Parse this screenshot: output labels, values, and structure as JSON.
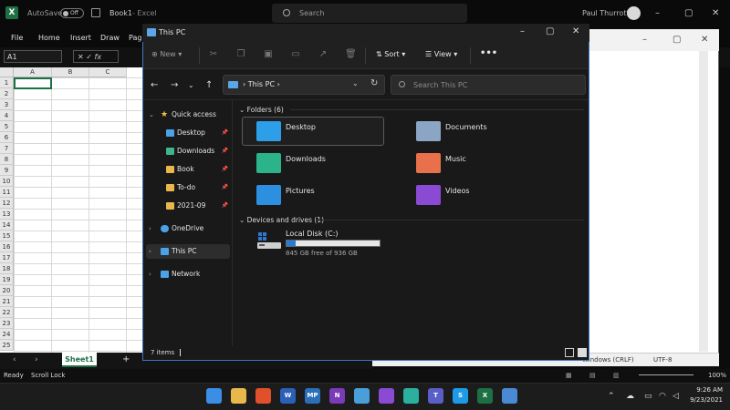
{
  "excel": {
    "autosave_label": "AutoSave",
    "autosave_state": "Off",
    "doc_title": "Book1",
    "doc_sep": "- Excel",
    "search_placeholder": "Search",
    "user_name": "Paul Thurrott",
    "menu": [
      "File",
      "Home",
      "Insert",
      "Draw",
      "Pag"
    ],
    "namebox": "A1",
    "fx_label": "fx",
    "columns": [
      "A",
      "B",
      "C"
    ],
    "rows": [
      "1",
      "2",
      "3",
      "4",
      "5",
      "6",
      "7",
      "8",
      "9",
      "10",
      "11",
      "12",
      "13",
      "14",
      "15",
      "16",
      "17",
      "18",
      "19",
      "20",
      "21",
      "22",
      "23",
      "24",
      "25"
    ],
    "sheet_tab": "Sheet1",
    "add_sheet": "+",
    "status_ready": "Ready",
    "status_scroll": "Scroll Lock",
    "zoom": "100%"
  },
  "notepad": {
    "status_pos": "UTF-8",
    "status_eol": "Windows (CRLF)",
    "status_enc": "UTF-8"
  },
  "explorer": {
    "title": "This PC",
    "cmd_new": "New",
    "cmd_sort": "Sort",
    "cmd_view": "View",
    "cmd_more": "•••",
    "address": "This PC",
    "search_placeholder": "Search This PC",
    "sidebar": [
      {
        "label": "Quick access",
        "icon": "star-icon",
        "color": "#f2c744"
      },
      {
        "label": "Desktop",
        "icon": "desktop-icon",
        "color": "#4aa3e8",
        "pinned": true
      },
      {
        "label": "Downloads",
        "icon": "download-icon",
        "color": "#3fb58c",
        "pinned": true
      },
      {
        "label": "Book",
        "icon": "folder-icon",
        "color": "#e8b84a",
        "pinned": true
      },
      {
        "label": "To-do",
        "icon": "folder-icon",
        "color": "#e8b84a",
        "pinned": true
      },
      {
        "label": "2021-09",
        "icon": "folder-icon",
        "color": "#e8b84a",
        "pinned": true
      },
      {
        "label": "OneDrive",
        "icon": "cloud-icon",
        "color": "#4aa3e8"
      },
      {
        "label": "This PC",
        "icon": "pc-icon",
        "color": "#4aa3e8"
      },
      {
        "label": "Network",
        "icon": "network-icon",
        "color": "#4aa3e8"
      }
    ],
    "folders_header": "Folders (6)",
    "folders": [
      {
        "label": "Desktop",
        "icon": "desktop-folder-icon",
        "color": "#2d9ee8",
        "selected": true
      },
      {
        "label": "Documents",
        "icon": "documents-folder-icon",
        "color": "#8aa6c4"
      },
      {
        "label": "Downloads",
        "icon": "downloads-folder-icon",
        "color": "#2bb38a"
      },
      {
        "label": "Music",
        "icon": "music-folder-icon",
        "color": "#e8704a"
      },
      {
        "label": "Pictures",
        "icon": "pictures-folder-icon",
        "color": "#2d8fe0"
      },
      {
        "label": "Videos",
        "icon": "videos-folder-icon",
        "color": "#8a4ad4"
      }
    ],
    "drives_header": "Devices and drives (1)",
    "drive": {
      "label": "Local Disk (C:)",
      "free_text": "845 GB free of 936 GB",
      "used_fraction": 0.097
    },
    "status_items": "7 items"
  },
  "taskbar": {
    "time": "9:26 AM",
    "date": "9/23/2021",
    "apps": [
      {
        "name": "start-icon",
        "color": "#3a8ee6",
        "glyph": ""
      },
      {
        "name": "file-explorer-icon",
        "color": "#e8b84a",
        "glyph": ""
      },
      {
        "name": "brave-icon",
        "color": "#e0502a",
        "glyph": ""
      },
      {
        "name": "word-icon",
        "color": "#2b5fb8",
        "glyph": "W"
      },
      {
        "name": "mp-icon",
        "color": "#2b6fb8",
        "glyph": "MP"
      },
      {
        "name": "onenote-icon",
        "color": "#7b3ab8",
        "glyph": "N"
      },
      {
        "name": "notepad-icon",
        "color": "#4a9fd8",
        "glyph": ""
      },
      {
        "name": "affinity-icon",
        "color": "#8a4ad4",
        "glyph": ""
      },
      {
        "name": "edge-icon",
        "color": "#2bb0a0",
        "glyph": ""
      },
      {
        "name": "teams-icon",
        "color": "#5a5fc8",
        "glyph": "T"
      },
      {
        "name": "skype-icon",
        "color": "#1e9be8",
        "glyph": "S"
      },
      {
        "name": "excel-icon",
        "color": "#1d7044",
        "glyph": "X"
      },
      {
        "name": "photos-icon",
        "color": "#4a8ad4",
        "glyph": ""
      }
    ]
  }
}
